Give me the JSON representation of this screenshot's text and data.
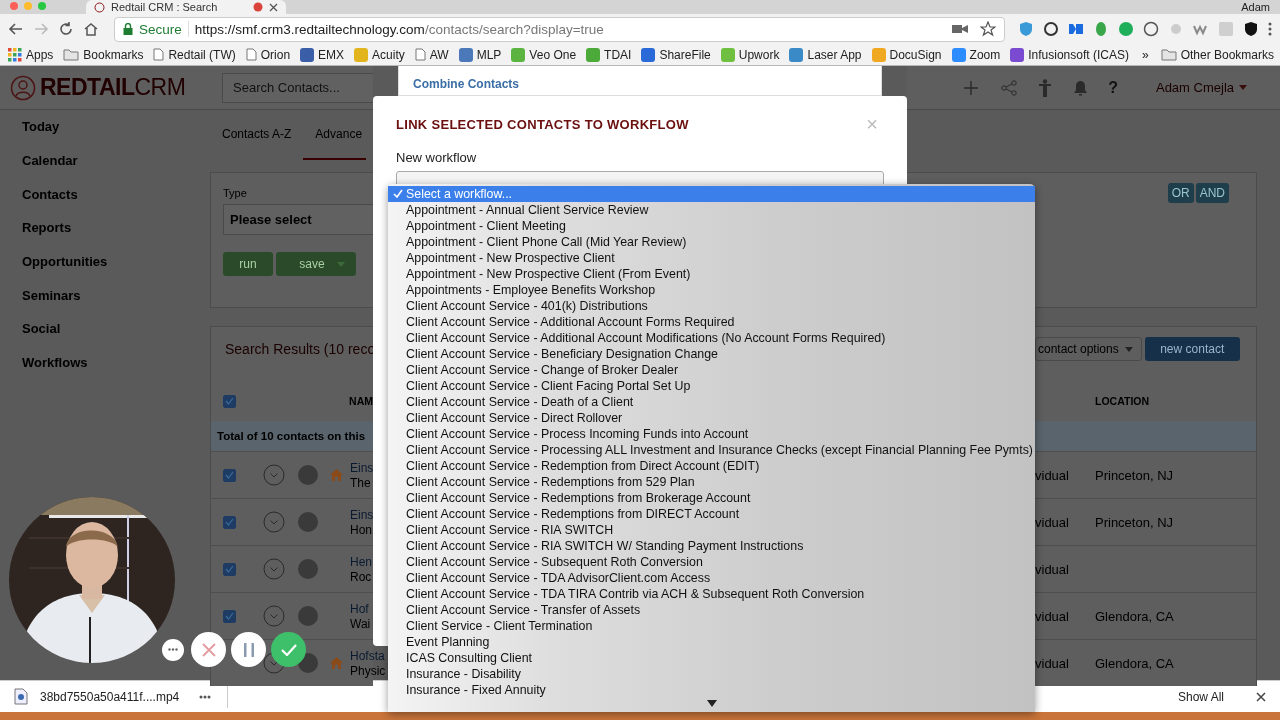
{
  "browser": {
    "tab_title": "Redtail CRM : Search",
    "profile": "Adam",
    "secure_label": "Secure",
    "url_host": "https://smf.crm3.redtailtechnology.com",
    "url_path": "/contacts/search?display=true"
  },
  "bookmarks": [
    {
      "label": "Apps",
      "kind": "grid"
    },
    {
      "label": "Bookmarks",
      "kind": "folder"
    },
    {
      "label": "Redtail (TW)",
      "kind": "page"
    },
    {
      "label": "Orion",
      "kind": "page"
    },
    {
      "label": "EMX",
      "kind": "badge",
      "color": "#3a5fa8"
    },
    {
      "label": "Acuity",
      "kind": "badge",
      "color": "#e2b51f"
    },
    {
      "label": "AW",
      "kind": "page"
    },
    {
      "label": "MLP",
      "kind": "badge",
      "color": "#4a78b8"
    },
    {
      "label": "Veo One",
      "kind": "badge",
      "color": "#5bb440"
    },
    {
      "label": "TDAI",
      "kind": "badge",
      "color": "#4caa3a"
    },
    {
      "label": "ShareFile",
      "kind": "badge",
      "color": "#2a6ad8"
    },
    {
      "label": "Upwork",
      "kind": "badge",
      "color": "#6fbf40"
    },
    {
      "label": "Laser App",
      "kind": "badge",
      "color": "#3a8ac8"
    },
    {
      "label": "DocuSign",
      "kind": "badge",
      "color": "#f0a820"
    },
    {
      "label": "Zoom",
      "kind": "badge",
      "color": "#2d8cff"
    },
    {
      "label": "Infusionsoft (ICAS)",
      "kind": "badge",
      "color": "#7a4ad0"
    }
  ],
  "bookmarks_overflow": "»",
  "other_bookmarks": "Other Bookmarks",
  "app": {
    "logo_bold": "REDTAIL",
    "logo_light": "CRM",
    "search_placeholder": "Search Contacts...",
    "help_label": "?",
    "user": "Adam Cmejla"
  },
  "sidebar": [
    {
      "label": "Today"
    },
    {
      "label": "Calendar"
    },
    {
      "label": "Contacts"
    },
    {
      "label": "Reports"
    },
    {
      "label": "Opportunities"
    },
    {
      "label": "Seminars"
    },
    {
      "label": "Social"
    },
    {
      "label": "Workflows"
    }
  ],
  "tabs": [
    {
      "label": "Contacts A-Z",
      "selected": false
    },
    {
      "label": "Advance",
      "selected": true
    }
  ],
  "filter": {
    "type_label": "Type",
    "type_placeholder": "Please select",
    "run": "run",
    "save": "save",
    "logic": [
      {
        "label": "OR"
      },
      {
        "label": "AND"
      }
    ]
  },
  "results": {
    "title": "Search Results (10 reco",
    "header_checked": true,
    "name_column": "NAM",
    "location_column": "LOCATION",
    "total": "Total of 10 contacts on this",
    "contact_options": "contact options",
    "new_contact": "new contact",
    "rows": [
      {
        "checked": true,
        "home": true,
        "name": "Eins",
        "company": "The",
        "type": "vidual",
        "location": "Princeton, NJ"
      },
      {
        "checked": true,
        "home": false,
        "name": "Eins",
        "company": "Hon",
        "type": "vidual",
        "location": "Princeton, NJ"
      },
      {
        "checked": true,
        "home": false,
        "name": "Hen",
        "company": "Roc",
        "type": "vidual"
      },
      {
        "checked": true,
        "home": false,
        "name": "Hof",
        "company": "Wai",
        "type": "vidual",
        "location": "Glendora, CA"
      },
      {
        "home": true,
        "name": "Hofsta",
        "company": "Physic",
        "type": "vidual",
        "location": "Glendora, CA"
      }
    ]
  },
  "modal": {
    "menu_item": "Combine Contacts",
    "title": "LINK SELECTED CONTACTS TO WORKFLOW",
    "close": "×",
    "field_label": "New workflow"
  },
  "dropdown": {
    "options": [
      {
        "label": "Select a workflow...",
        "selected": true
      },
      {
        "label": "Appointment - Annual Client Service Review",
        "selected": false
      },
      {
        "label": "Appointment - Client Meeting",
        "selected": false
      },
      {
        "label": "Appointment - Client Phone Call (Mid Year Review)",
        "selected": false
      },
      {
        "label": "Appointment - New Prospective Client",
        "selected": false
      },
      {
        "label": "Appointment - New Prospective Client (From Event)",
        "selected": false
      },
      {
        "label": "Appointments - Employee Benefits Workshop",
        "selected": false
      },
      {
        "label": "Client Account Service - 401(k) Distributions",
        "selected": false
      },
      {
        "label": "Client Account Service - Additional Account Forms Required",
        "selected": false
      },
      {
        "label": "Client Account Service - Additional Account Modifications (No Account Forms Required)",
        "selected": false
      },
      {
        "label": "Client Account Service - Beneficiary Designation Change",
        "selected": false
      },
      {
        "label": "Client Account Service - Change of Broker Dealer",
        "selected": false
      },
      {
        "label": "Client Account Service - Client Facing Portal Set Up",
        "selected": false
      },
      {
        "label": "Client Account Service - Death of a Client",
        "selected": false
      },
      {
        "label": "Client Account Service - Direct Rollover",
        "selected": false
      },
      {
        "label": "Client Account Service - Process Incoming Funds into Account",
        "selected": false
      },
      {
        "label": "Client Account Service - Processing ALL Investment and Insurance Checks (except Financial Planning Fee Pymts)",
        "selected": false
      },
      {
        "label": "Client Account Service - Redemption from Direct Account (EDIT)",
        "selected": false
      },
      {
        "label": "Client Account Service - Redemptions from 529 Plan",
        "selected": false
      },
      {
        "label": "Client Account Service - Redemptions from Brokerage Account",
        "selected": false
      },
      {
        "label": "Client Account Service - Redemptions from DIRECT Account",
        "selected": false
      },
      {
        "label": "Client Account Service - RIA SWITCH",
        "selected": false
      },
      {
        "label": "Client Account Service - RIA SWITCH W/ Standing Payment Instructions",
        "selected": false
      },
      {
        "label": "Client Account Service - Subsequent Roth Conversion",
        "selected": false
      },
      {
        "label": "Client Account Service - TDA AdvisorClient.com Access",
        "selected": false
      },
      {
        "label": "Client Account Service - TDA TIRA Contrib via ACH & Subsequent Roth Conversion",
        "selected": false
      },
      {
        "label": "Client Account Service - Transfer of Assets",
        "selected": false
      },
      {
        "label": "Client Service - Client Termination",
        "selected": false
      },
      {
        "label": "Event Planning",
        "selected": false
      },
      {
        "label": "ICAS Consulting Client",
        "selected": false
      },
      {
        "label": "Insurance - Disability",
        "selected": false
      },
      {
        "label": "Insurance - Fixed Annuity",
        "selected": false
      }
    ]
  },
  "downloads": {
    "file": "38bd7550a50a411f....mp4",
    "show_all": "Show All"
  }
}
